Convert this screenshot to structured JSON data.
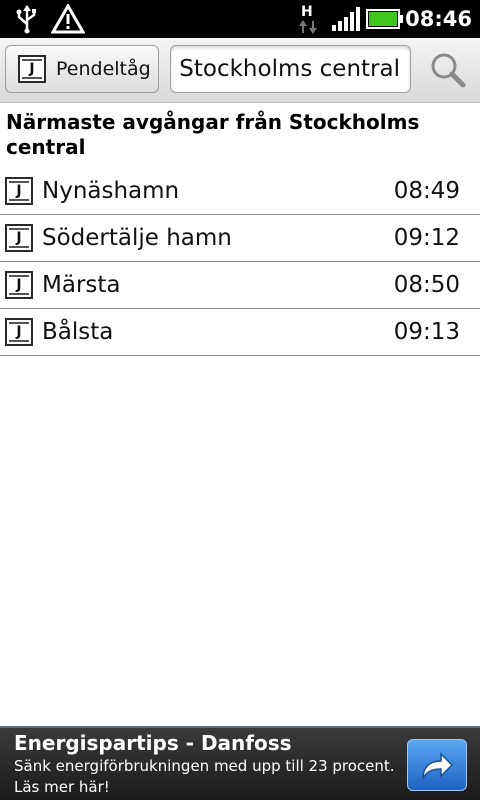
{
  "statusbar": {
    "time": "08:46",
    "network_type": "H",
    "icons": [
      "usb-icon",
      "warning-icon",
      "data-transfer-icon",
      "signal-icon",
      "battery-icon"
    ]
  },
  "toolbar": {
    "transport_button_label": "Pendeltåg",
    "transport_icon_letter": "J",
    "search_value": "Stockholms central",
    "search_icon": "magnifier-icon"
  },
  "heading": "Närmaste avgångar från Stockholms central",
  "departures": [
    {
      "icon_letter": "J",
      "destination": "Nynäshamn",
      "time": "08:49"
    },
    {
      "icon_letter": "J",
      "destination": "Södertälje hamn",
      "time": "09:12"
    },
    {
      "icon_letter": "J",
      "destination": "Märsta",
      "time": "08:50"
    },
    {
      "icon_letter": "J",
      "destination": "Bålsta",
      "time": "09:13"
    }
  ],
  "ad": {
    "title": "Energispartips - Danfoss",
    "text": "Sänk energiförbrukningen med upp till 23 procent. Läs mer här!",
    "icon": "share-arrow-icon"
  },
  "colors": {
    "statusbar_bg": "#000000",
    "battery_green": "#3fc51e",
    "ad_button_blue": "#2f7fd8"
  }
}
